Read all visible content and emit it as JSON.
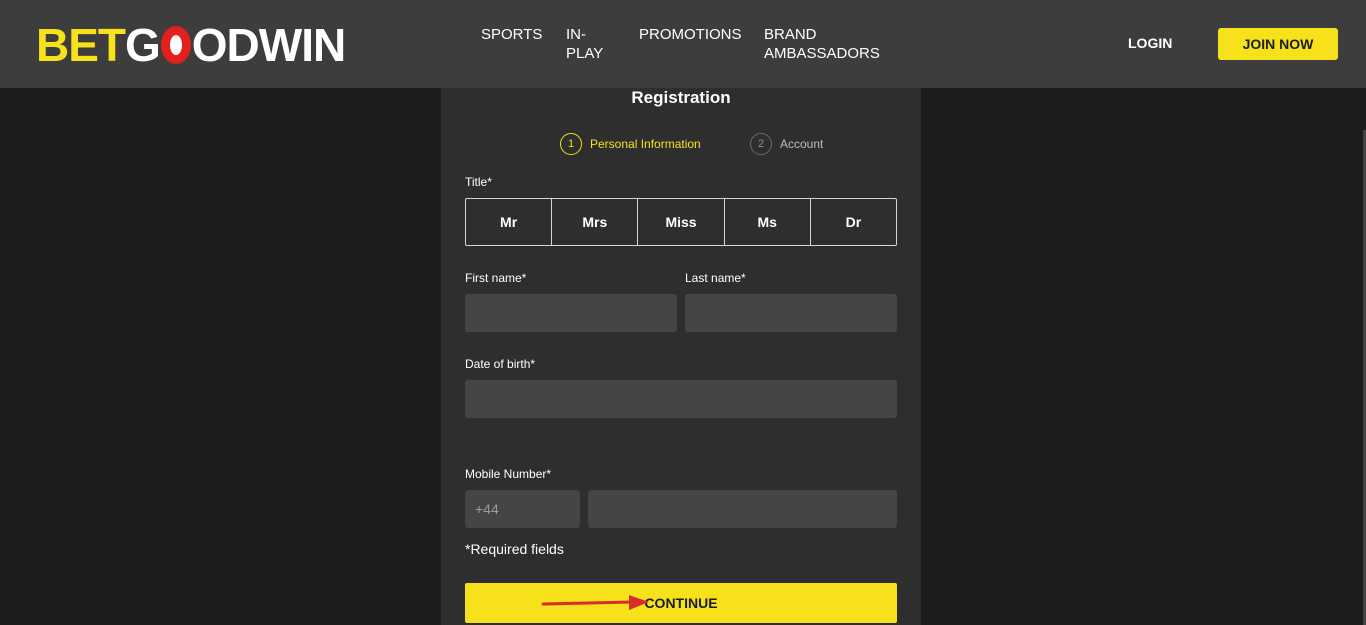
{
  "header": {
    "logo": {
      "part1": "BET",
      "part2_letter_g": "G",
      "part2_rest": "ODWIN"
    },
    "nav": [
      {
        "label": "SPORTS"
      },
      {
        "label": "IN-PLAY"
      },
      {
        "label": "PROMOTIONS"
      },
      {
        "label": "BRAND AMBASSADORS"
      }
    ],
    "login_label": "LOGIN",
    "join_label": "JOIN NOW"
  },
  "form": {
    "title": "Registration",
    "steps": [
      {
        "number": "1",
        "label": "Personal Information",
        "active": true
      },
      {
        "number": "2",
        "label": "Account",
        "active": false
      }
    ],
    "title_label": "Title*",
    "title_options": [
      "Mr",
      "Mrs",
      "Miss",
      "Ms",
      "Dr"
    ],
    "first_name_label": "First name*",
    "first_name_value": "",
    "last_name_label": "Last name*",
    "last_name_value": "",
    "dob_label": "Date of birth*",
    "dob_value": "",
    "mobile_label": "Mobile Number*",
    "mobile_prefix": "+44",
    "mobile_value": "",
    "required_note": "*Required fields",
    "continue_label": "CONTINUE"
  },
  "colors": {
    "accent": "#f7e11b",
    "header_bg": "#3d3d3d",
    "page_bg": "#1c1c1c",
    "panel_bg": "#2e2e2e",
    "field_bg": "#454545",
    "arrow": "#d32f2f",
    "logo_o": "#e3201b"
  }
}
